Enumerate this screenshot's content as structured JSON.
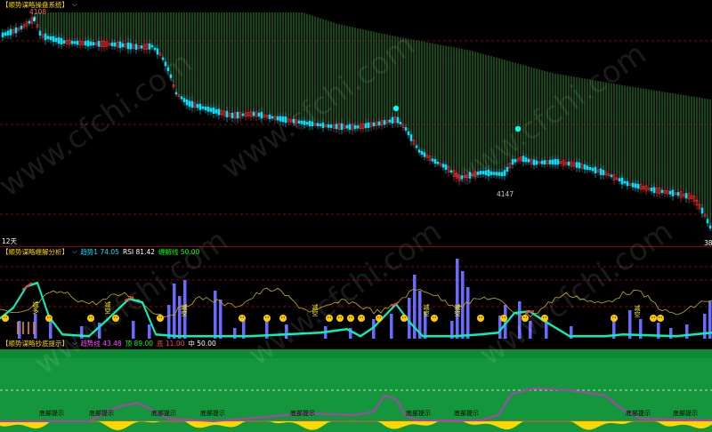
{
  "panel1": {
    "title": "【顺势谋略操盘系统】",
    "peak_label": "4108",
    "low_label": "4147",
    "period_label": "12天",
    "right_edge_label": "38"
  },
  "panel2": {
    "title": "【顺势谋略缠解分析】",
    "values": [
      {
        "text": "趋势1 74.05",
        "color": "#00e5ff"
      },
      {
        "text": "RSI 81.42",
        "color": "#ffffff"
      },
      {
        "text": "缠解线 50.00",
        "color": "#00ff00"
      }
    ],
    "signal_labels": [
      "减",
      "多",
      "减",
      "空",
      "减",
      "空",
      "减",
      "空",
      "减",
      "空",
      "减",
      "空",
      "减",
      "空"
    ]
  },
  "panel3": {
    "title": "【顺势谋略抄底提示】",
    "values": [
      {
        "text": "趋势线 43.48",
        "color": "#ff44ff"
      },
      {
        "text": "顶 89.00",
        "color": "#00ff00"
      },
      {
        "text": "底 11.00",
        "color": "#ff4444"
      },
      {
        "text": "中 50.00",
        "color": "#ffffff"
      }
    ],
    "bottom_hint": "底部提示"
  },
  "watermark": "www.cfchi.com",
  "colors": {
    "up": "#ff3333",
    "down": "#00e5ff",
    "cloud": "#2e8b2e",
    "green_panel": "#14963c",
    "trend_purple": "#b040b0",
    "separator": "#8b0000"
  }
}
